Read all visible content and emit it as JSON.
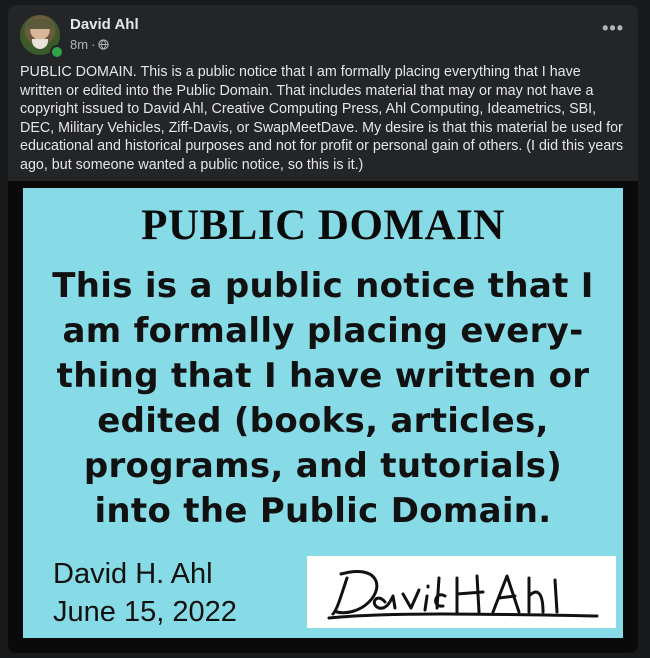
{
  "post": {
    "author": "David Ahl",
    "timestamp": "8m",
    "separator": "·",
    "privacy_icon": "globe-icon",
    "more_icon": "more-options-icon",
    "more_label": "•••",
    "caption": "PUBLIC DOMAIN. This is a public notice that I am formally placing everything that I have written or edited into the Public Domain. That includes material that may or may not have a copyright issued to David Ahl, Creative Computing Press, Ahl Computing, Ideametrics, SBI, DEC, Military Vehicles, Ziff-Davis, or SwapMeetDave. My desire is that this material be used for educational and historical purposes and not for profit or personal gain of others. (I did this years ago, but someone wanted a public notice, so this is it.)"
  },
  "notice": {
    "title": "PUBLIC DOMAIN",
    "lines": [
      "This is a public notice that I",
      "am formally placing every-",
      "thing that I have written or",
      "edited (books, articles,",
      "programs, and tutorials)",
      "into the Public Domain."
    ],
    "signer": "David H. Ahl",
    "date": "June 15, 2022",
    "signature_text": "DavidHAhl"
  },
  "colors": {
    "page_bg": "#18191a",
    "post_bg": "#242526",
    "card_bg": "#86dbe6",
    "online": "#31a24c"
  }
}
